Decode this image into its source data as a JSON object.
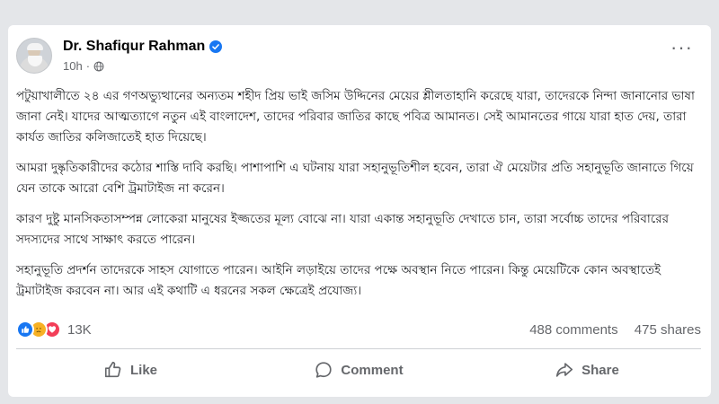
{
  "post": {
    "author": "Dr. Shafiqur Rahman",
    "time": "10h",
    "separator": "·",
    "more": "···",
    "paragraphs": [
      "পটুয়াখালীতে ২৪ এর গণঅভ্যুত্থানের অন্যতম শহীদ প্রিয় ভাই জসিম উদ্দিনের মেয়ের শ্লীলতাহানি করেছে যারা, তাদেরকে নিন্দা জানানোর ভাষা জানা নেই। যাদের আত্মত্যাগে নতুন এই বাংলাদেশ, তাদের পরিবার জাতির কাছে পবিত্র আমানত। সেই আমানতের গায়ে যারা হাত দেয়, তারা কার্যত জাতির কলিজাতেই হাত দিয়েছে।",
      "আমরা দুষ্কৃতিকারীদের কঠোর শাস্তি দাবি করছি। পাশাপাশি এ ঘটনায় যারা সহানুভূতিশীল হবেন, তারা ঐ মেয়েটার প্রতি সহানুভূতি জানাতে গিয়ে যেন তাকে আরো বেশি ট্রমাটাইজ না করেন।",
      "কারণ দুষ্টু মানসিকতাসম্পন্ন লোকেরা মানুষের ইজ্জতের মূল্য বোঝে না। যারা একান্ত সহানুভূতি দেখাতে চান, তারা সর্বোচ্চ তাদের পরিবারের সদস্যদের সাথে সাক্ষাৎ করতে পারেন।",
      "সহানুভূতি প্রদর্শন তাদেরকে সাহস যোগাতে পারেন। আইনি লড়াইয়ে তাদের পক্ষে অবস্থান নিতে পারেন। কিন্তু মেয়েটিকে কোন অবস্থাতেই ট্রমাটাইজ করবেন না। আর এই কথাটি এ ধরনের সকল ক্ষেত্রেই প্রযোজ্য।"
    ]
  },
  "stats": {
    "reaction_count": "13K",
    "comments": "488 comments",
    "shares": "475 shares"
  },
  "actions": {
    "like": "Like",
    "comment": "Comment",
    "share": "Share"
  },
  "icons": {
    "verified": "verified-badge-icon",
    "audience": "globe-icon",
    "reactions": [
      "like-reaction-icon",
      "sad-reaction-icon",
      "love-reaction-icon"
    ],
    "like": "thumbs-up-icon",
    "comment": "speech-bubble-icon",
    "share": "share-arrow-icon"
  },
  "colors": {
    "brand_blue": "#1877f2",
    "text": "#050505",
    "secondary": "#65676b",
    "background": "#e4e6e9"
  }
}
